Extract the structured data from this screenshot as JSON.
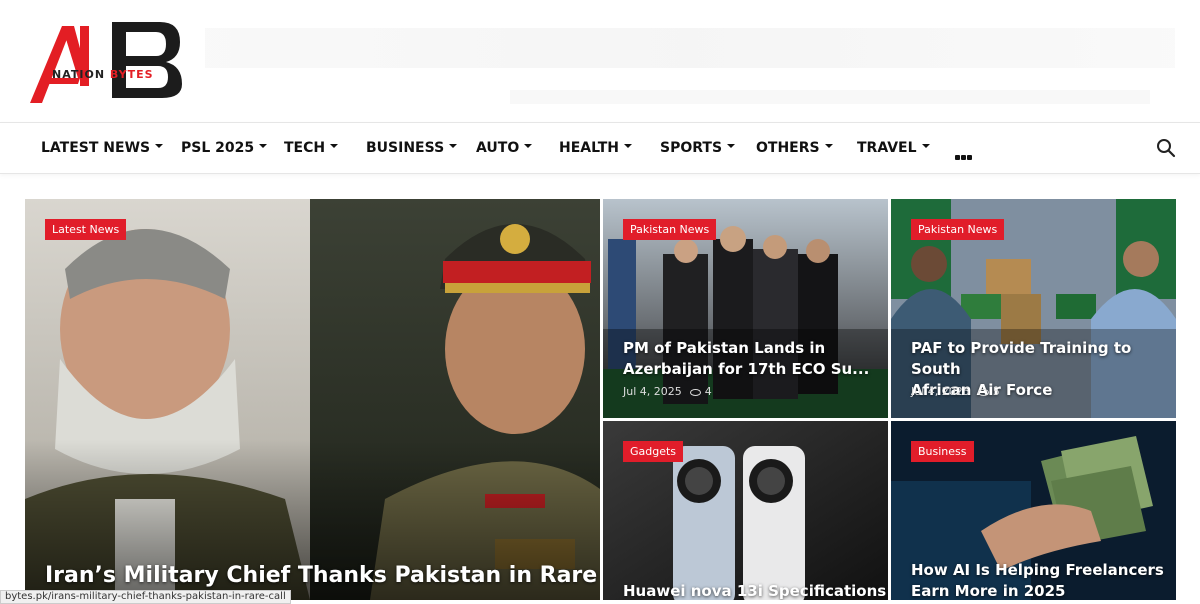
{
  "site": {
    "logo_letters": "AIB",
    "logo_word1": "NATION",
    "logo_word2": "BYTES"
  },
  "nav": {
    "items": [
      {
        "label": "LATEST NEWS",
        "has_caret": true
      },
      {
        "label": "PSL 2025",
        "has_caret": true
      },
      {
        "label": "TECH",
        "has_caret": true
      },
      {
        "label": "BUSINESS",
        "has_caret": true
      },
      {
        "label": "AUTO",
        "has_caret": true
      },
      {
        "label": "HEALTH",
        "has_caret": true
      },
      {
        "label": "SPORTS",
        "has_caret": true
      },
      {
        "label": "OTHERS",
        "has_caret": true
      },
      {
        "label": "TRAVEL",
        "has_caret": true
      }
    ],
    "more_icon": "more-dots-icon",
    "search_icon": "search-icon"
  },
  "featured": {
    "badge": "Latest News",
    "title": "Iran’s Military Chief Thanks Pakistan in Rare Call"
  },
  "cards": [
    {
      "badge": "Pakistan News",
      "title_line1": "PM of Pakistan Lands in",
      "title_line2": "Azerbaijan for 17th ECO Su...",
      "date": "Jul 4, 2025",
      "views": "4"
    },
    {
      "badge": "Pakistan News",
      "title_line1": "PAF to Provide Training to South",
      "title_line2": "African Air Force",
      "date": "Jul 4, 2025",
      "views": "5"
    },
    {
      "badge": "Gadgets",
      "title_line1": "Huawei nova 13i Specifications",
      "title_line2": ""
    },
    {
      "badge": "Business",
      "title_line1": "How AI Is Helping Freelancers",
      "title_line2": "Earn More in 2025"
    }
  ],
  "status_url": "bytes.pk/irans-military-chief-thanks-pakistan-in-rare-call",
  "colors": {
    "accent": "#e11d2a",
    "text": "#111111"
  }
}
